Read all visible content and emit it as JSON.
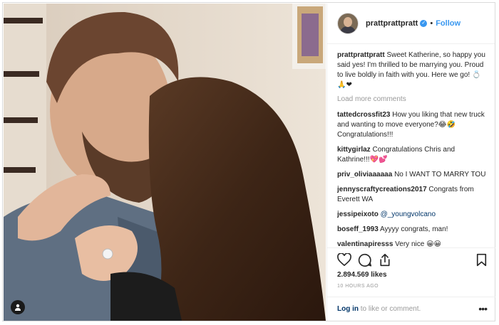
{
  "post": {
    "username": "prattprattpratt",
    "separator": "•",
    "follow_label": "Follow",
    "caption_user": "prattprattpratt",
    "caption_text": "Sweet Katherine, so happy you said yes! I'm thrilled to be marrying you. Proud to live boldly in faith with you. Here we go! 💍🙏❤",
    "load_more": "Load more comments",
    "comments": [
      {
        "user": "tattedcrossfit23",
        "text": "How you liking that new truck and wanting to move everyone?😂🤣 Congratulations!!!"
      },
      {
        "user": "kittygirlaz",
        "text": "Congratulations Chris and Kathrine!!!💖💕"
      },
      {
        "user": "priv_oliviaaaaaa",
        "text": "No I WANT TO MARRY TOU"
      },
      {
        "user": "jennyscraftycreations2017",
        "text": "Congrats from Everett WA"
      },
      {
        "user": "jessipeixoto",
        "text": "",
        "mention": "@_youngvolcano"
      },
      {
        "user": "boseff_1993",
        "text": "Ayyyy congrats, man!"
      },
      {
        "user": "valentinapiresss",
        "text": "Very nice 😀😀"
      }
    ],
    "likes": "2.894.569 likes",
    "timestamp": "10 HOURS AGO",
    "login_link": "Log in",
    "login_suffix": " to like or comment.",
    "more_icon": "•••"
  },
  "icons": {
    "like": "heart-icon",
    "comment": "comment-bubble-icon",
    "share": "share-icon",
    "save": "bookmark-icon",
    "user_tag": "person-icon",
    "verified": "verified-check-icon"
  },
  "colors": {
    "link_blue": "#3897f0",
    "muted": "#999999",
    "text": "#262626",
    "mention": "#003569"
  }
}
